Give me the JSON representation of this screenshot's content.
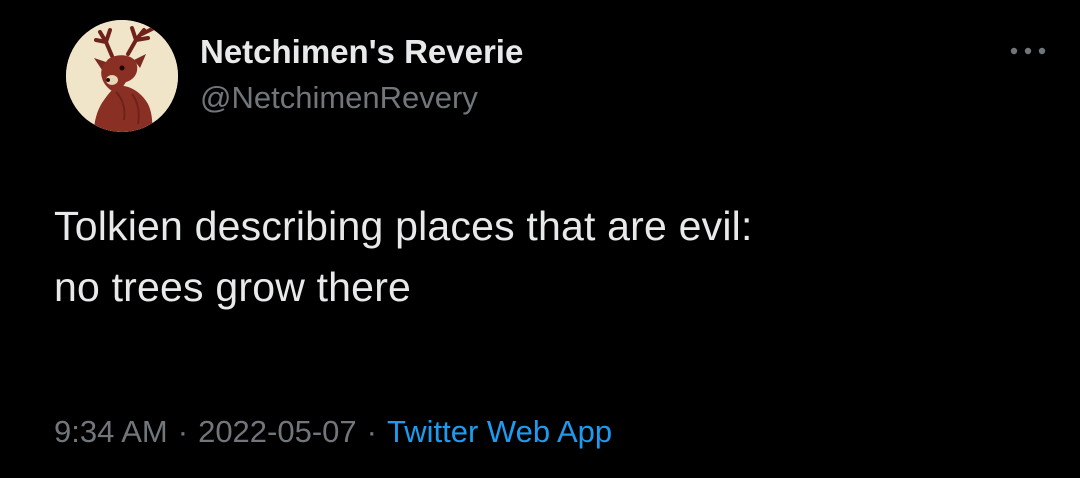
{
  "author": {
    "display_name": "Netchimen's Reverie",
    "handle": "@NetchimenRevery",
    "avatar_icon": "deer-avatar-icon"
  },
  "tweet": {
    "lines": [
      "Tolkien describing places that are evil:",
      "no trees grow there"
    ]
  },
  "meta": {
    "time": "9:34 AM",
    "date": "2022-05-07",
    "separator": "·",
    "source": "Twitter Web App"
  },
  "more_icon": "more-options-icon",
  "colors": {
    "background": "#000000",
    "text": "#e7e9ea",
    "secondary_text": "#71767b",
    "link": "#1d9bf0",
    "avatar_bg": "#f0e4c9",
    "deer": "#8a2f24"
  }
}
